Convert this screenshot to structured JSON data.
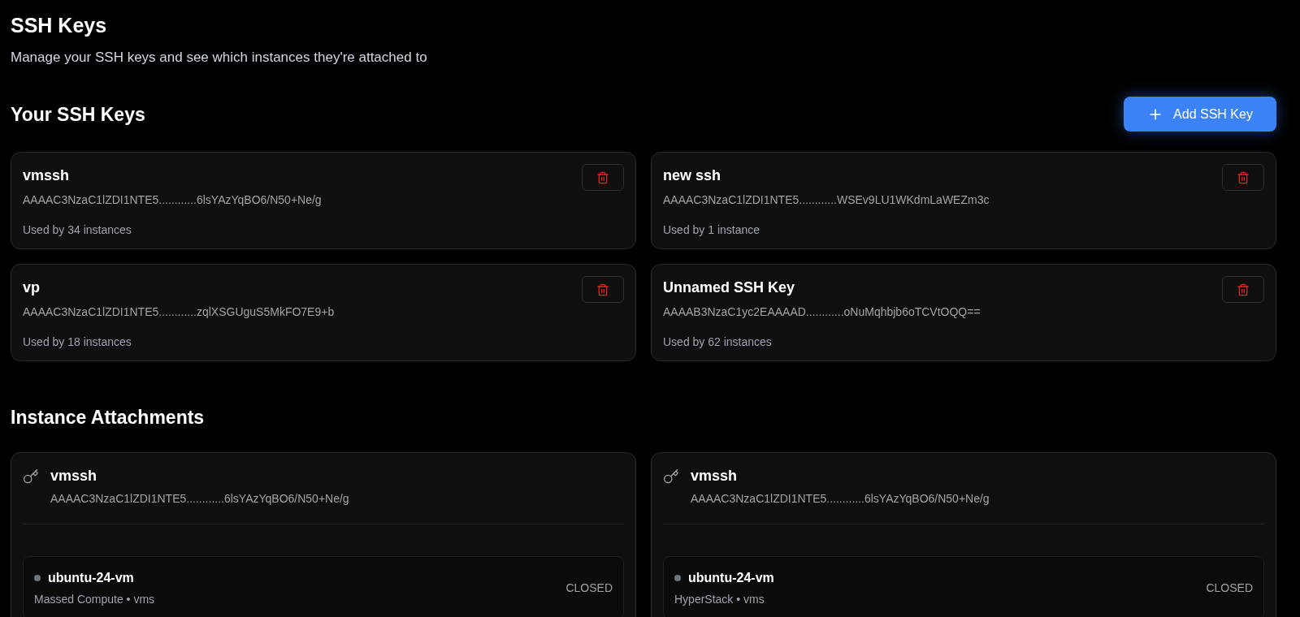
{
  "page": {
    "title": "SSH Keys",
    "subtitle": "Manage your SSH keys and see which instances they're attached to"
  },
  "keys_section": {
    "heading": "Your SSH Keys",
    "add_button": "Add SSH Key"
  },
  "keys": [
    {
      "name": "vmssh",
      "fingerprint": "AAAAC3NzaC1lZDI1NTE5............6lsYAzYqBO6/N50+Ne/g",
      "usage": "Used by 34 instances"
    },
    {
      "name": "new ssh",
      "fingerprint": "AAAAC3NzaC1lZDI1NTE5............WSEv9LU1WKdmLaWEZm3c",
      "usage": "Used by 1 instance"
    },
    {
      "name": "vp",
      "fingerprint": "AAAAC3NzaC1lZDI1NTE5............zqlXSGUguS5MkFO7E9+b",
      "usage": "Used by 18 instances"
    },
    {
      "name": "Unnamed SSH Key",
      "fingerprint": "AAAAB3NzaC1yc2EAAAAD............oNuMqhbjb6oTCVtOQQ==",
      "usage": "Used by 62 instances"
    }
  ],
  "attachments_section": {
    "heading": "Instance Attachments"
  },
  "attachments": [
    {
      "key_name": "vmssh",
      "fingerprint": "AAAAC3NzaC1lZDI1NTE5............6lsYAzYqBO6/N50+Ne/g",
      "instances": [
        {
          "name": "ubuntu-24-vm",
          "details": "Massed Compute • vms",
          "status": "CLOSED",
          "color": "#6b7280"
        }
      ]
    },
    {
      "key_name": "vmssh",
      "fingerprint": "AAAAC3NzaC1lZDI1NTE5............6lsYAzYqBO6/N50+Ne/g",
      "instances": [
        {
          "name": "ubuntu-24-vm",
          "details": "HyperStack • vms",
          "status": "CLOSED",
          "color": "#6b7280"
        }
      ]
    }
  ]
}
